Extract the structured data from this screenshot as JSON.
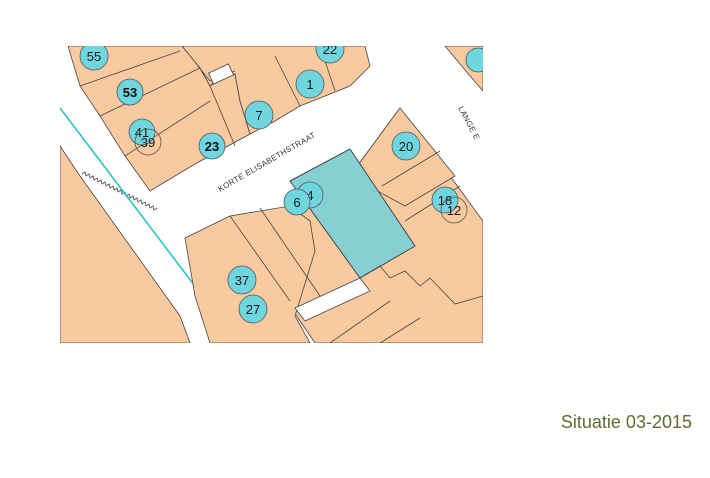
{
  "caption": "Situatie 03-2015",
  "colors": {
    "parcel": "#f9c9a0",
    "highlight_parcel": "#86cfd3",
    "house_number_marker": "#6fd6e0",
    "water_line": "#2ec0c0",
    "road": "#ffffff",
    "caption_text": "#5a6e2e"
  },
  "streets": {
    "korte": "KORTE ELISABETHSTRAAT",
    "lange": "LANGE E"
  },
  "house_numbers": {
    "n55": "55",
    "n22": "22",
    "n1": "1",
    "n53": "53",
    "n7": "7",
    "n41": "41",
    "n39": "39",
    "n23": "23",
    "n20": "20",
    "n6": "6",
    "n4": "4",
    "n18": "18",
    "n12": "12",
    "n37": "37",
    "n27": "27"
  }
}
